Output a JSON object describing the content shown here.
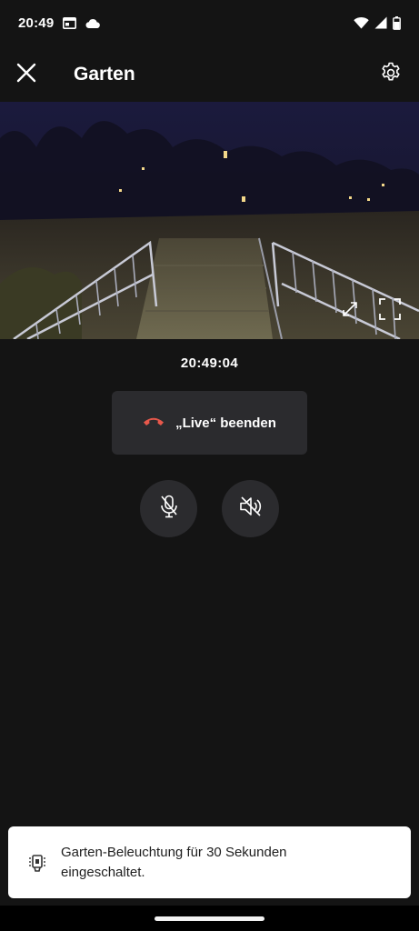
{
  "status_bar": {
    "time": "20:49",
    "icons": [
      "calendar-icon",
      "cloud-icon",
      "wifi-icon",
      "signal-icon",
      "battery-icon"
    ]
  },
  "header": {
    "title": "Garten",
    "close_icon": "close-icon",
    "settings_icon": "gear-icon"
  },
  "camera": {
    "controls": [
      "expand-icon",
      "fullscreen-icon"
    ]
  },
  "live": {
    "timestamp": "20:49:04",
    "end_live_label": "„Live“ beenden",
    "end_live_icon": "hang-up-icon",
    "end_live_icon_color": "#e8584b",
    "mic_icon": "microphone-muted-icon",
    "speaker_icon": "speaker-muted-icon"
  },
  "toast": {
    "icon": "light-icon",
    "message": "Garten-Beleuchtung für 30 Sekunden eingeschaltet."
  },
  "colors": {
    "background": "#141414",
    "button_background": "#2b2b2e",
    "toast_background": "#ffffff"
  }
}
